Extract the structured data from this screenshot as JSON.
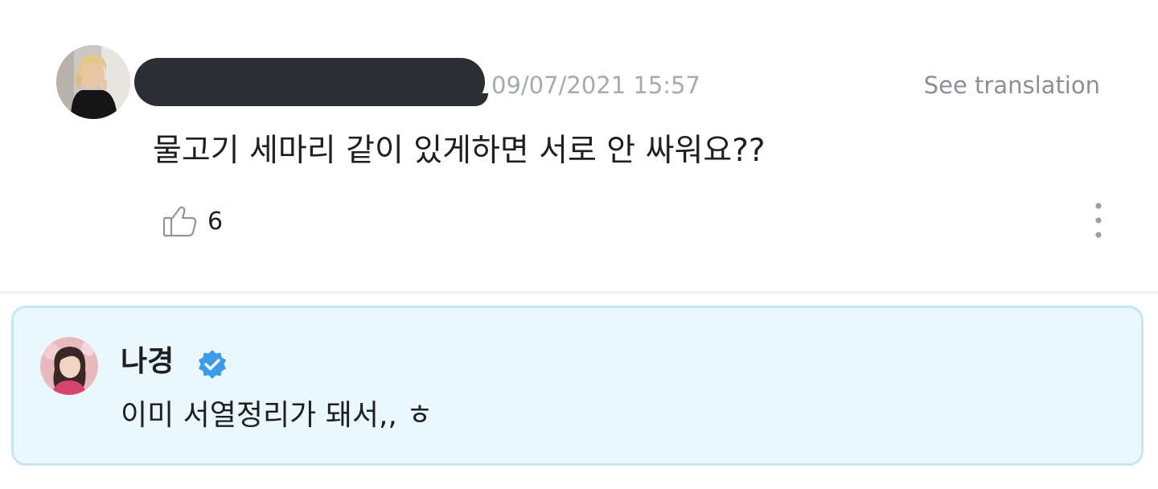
{
  "comment": {
    "timestamp": "09/07/2021 15:57",
    "see_translation_label": "See translation",
    "text": "물고기 세마리 같이 있게하면 서로 안 싸워요??",
    "like_count": "6",
    "like_icon": "thumbs-up-icon",
    "more_icon": "more-vertical-icon"
  },
  "artist_reply": {
    "name": "나경",
    "badge_icon": "verified-badge-icon",
    "badge_color": "#3d9be9",
    "text": "이미 서열정리가 돼서,, ㅎ"
  },
  "colors": {
    "reply_background": "#eaf7fd",
    "reply_border": "#c6e6f2",
    "timestamp": "#a6abb2",
    "text": "#1e1f22"
  }
}
